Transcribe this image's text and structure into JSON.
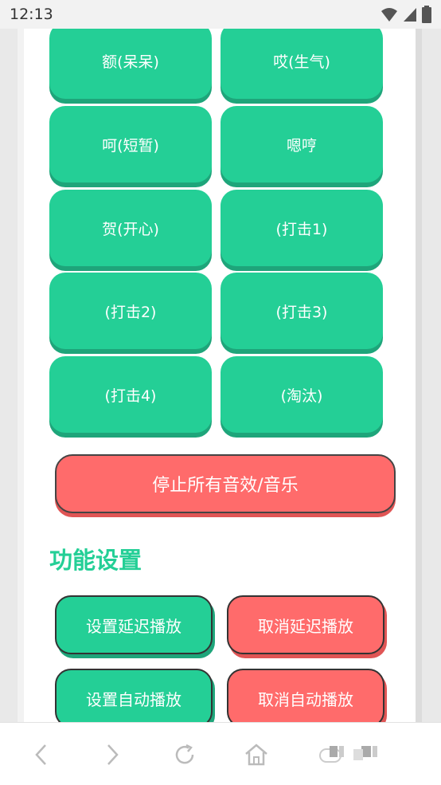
{
  "status_bar": {
    "time": "12:13",
    "icons": [
      "wifi-icon",
      "signal-icon",
      "battery-icon"
    ]
  },
  "sound_buttons": [
    "额(呆呆)",
    "哎(生气)",
    "呵(短暂)",
    "嗯哼",
    "贺(开心)",
    "(打击1)",
    "(打击2)",
    "(打击3)",
    "(打击4)",
    "(淘汰)"
  ],
  "stop_button": "停止所有音效/音乐",
  "settings": {
    "title": "功能设置",
    "set_delay": "设置延迟播放",
    "cancel_delay": "取消延迟播放",
    "set_auto": "设置自动播放",
    "cancel_auto": "取消自动播放"
  },
  "colors": {
    "accent_green": "#24cf96",
    "accent_red": "#ff6b6b"
  },
  "browser_nav": [
    "back-icon",
    "forward-icon",
    "refresh-icon",
    "home-icon",
    "tabs-icon"
  ]
}
